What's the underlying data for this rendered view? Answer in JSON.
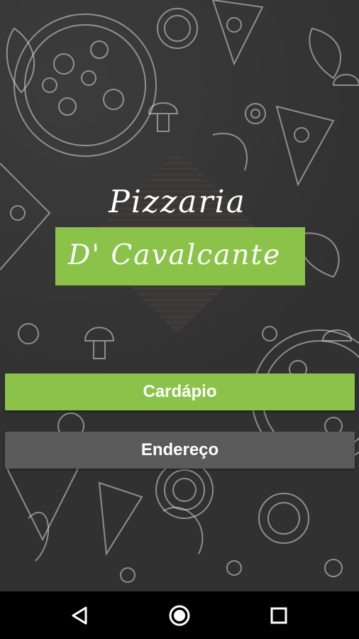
{
  "app": {
    "title_line1": "Pizzaria",
    "title_line2": "D' Cavalcante",
    "accent_color": "#8bc34a"
  },
  "buttons": {
    "menu_label": "Cardápio",
    "address_label": "Endereço"
  },
  "navbar": {
    "back_icon": "back-triangle-icon",
    "home_icon": "home-circle-icon",
    "recents_icon": "recents-square-icon"
  }
}
